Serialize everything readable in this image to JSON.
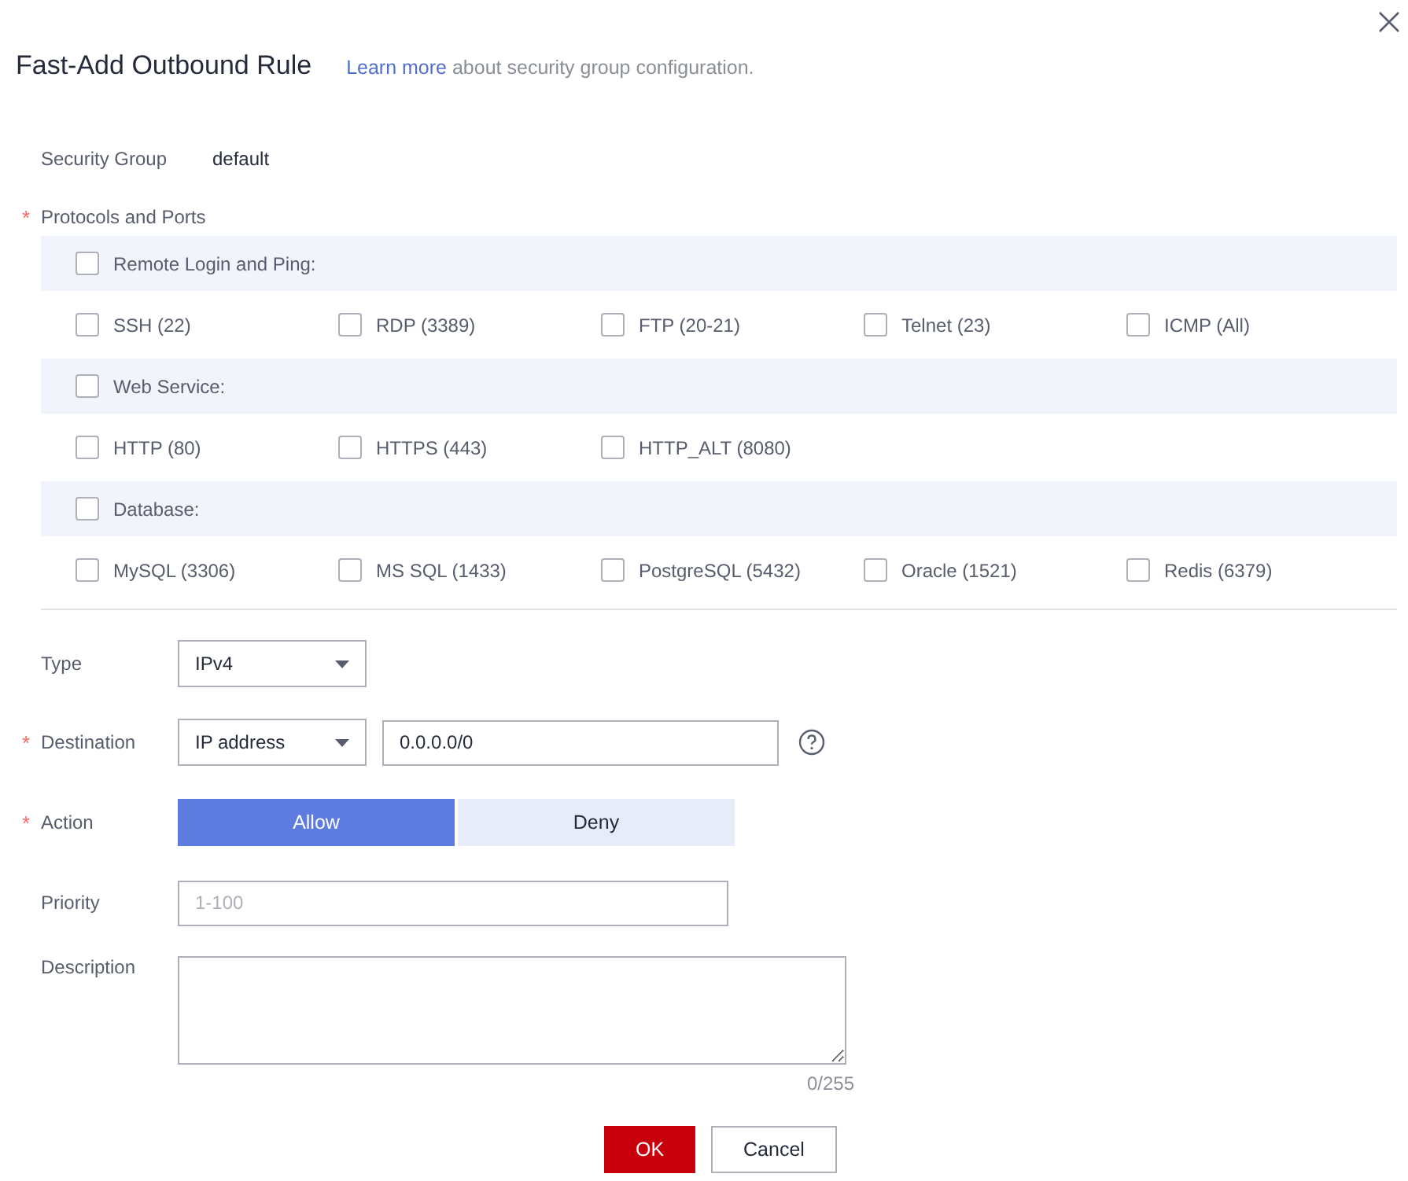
{
  "title": "Fast-Add Outbound Rule",
  "required_mark": "*",
  "help": {
    "link": "Learn more",
    "text": "about security group configuration."
  },
  "security_group": {
    "label": "Security Group",
    "value": "default"
  },
  "protocols": {
    "label": "Protocols and Ports",
    "required": true,
    "groups": [
      {
        "label": "Remote Login and Ping:",
        "checked": false,
        "items": [
          {
            "label": "SSH (22)",
            "checked": false
          },
          {
            "label": "RDP (3389)",
            "checked": false
          },
          {
            "label": "FTP (20-21)",
            "checked": false
          },
          {
            "label": "Telnet (23)",
            "checked": false
          },
          {
            "label": "ICMP (All)",
            "checked": false
          }
        ]
      },
      {
        "label": "Web Service:",
        "checked": false,
        "items": [
          {
            "label": "HTTP (80)",
            "checked": false
          },
          {
            "label": "HTTPS (443)",
            "checked": false
          },
          {
            "label": "HTTP_ALT (8080)",
            "checked": false
          }
        ]
      },
      {
        "label": "Database:",
        "checked": false,
        "items": [
          {
            "label": "MySQL (3306)",
            "checked": false
          },
          {
            "label": "MS SQL (1433)",
            "checked": false
          },
          {
            "label": "PostgreSQL (5432)",
            "checked": false
          },
          {
            "label": "Oracle (1521)",
            "checked": false
          },
          {
            "label": "Redis (6379)",
            "checked": false
          }
        ]
      }
    ]
  },
  "type": {
    "label": "Type",
    "required": false,
    "value": "IPv4"
  },
  "destination": {
    "label": "Destination",
    "required": true,
    "select": "IP address",
    "value": "0.0.0.0/0"
  },
  "action": {
    "label": "Action",
    "required": true,
    "options": [
      {
        "label": "Allow",
        "selected": true
      },
      {
        "label": "Deny",
        "selected": false
      }
    ]
  },
  "priority": {
    "label": "Priority",
    "required": false,
    "placeholder": "1-100"
  },
  "description": {
    "label": "Description",
    "required": false,
    "counter": "0/255"
  },
  "buttons": [
    {
      "label": "OK",
      "kind": "primary"
    },
    {
      "label": "Cancel",
      "kind": "secondary"
    }
  ]
}
